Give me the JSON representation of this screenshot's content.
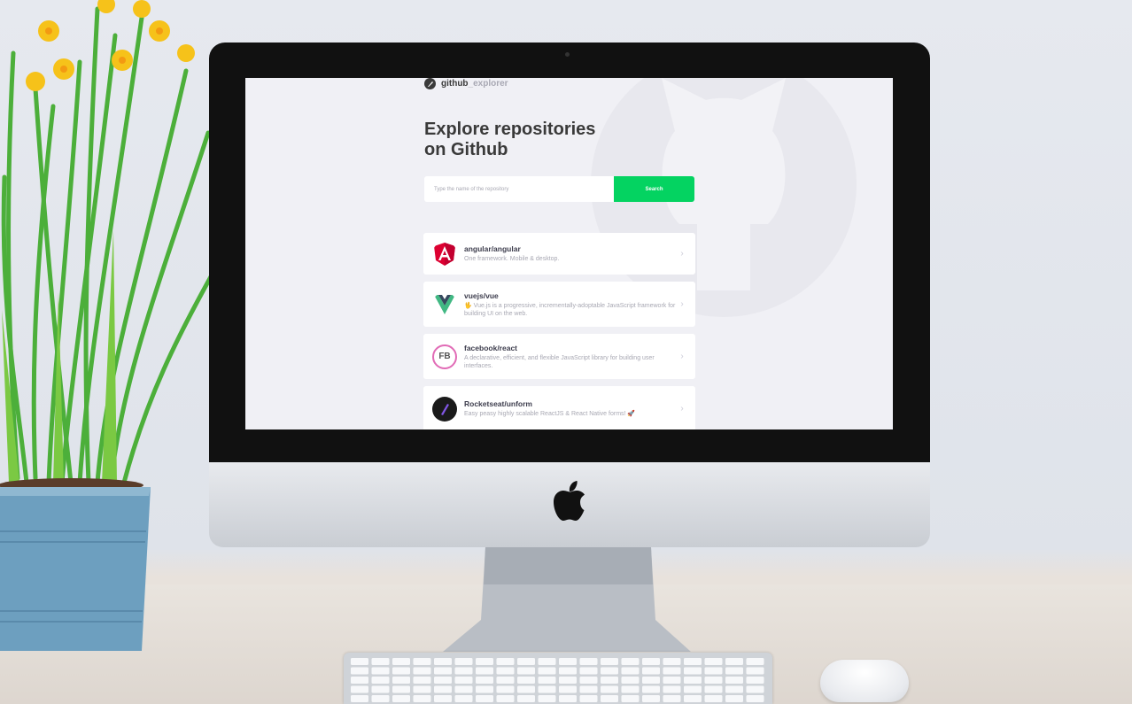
{
  "app": {
    "brand_name": "github",
    "brand_suffix": "_explorer",
    "title_line1": "Explore repositories",
    "title_line2": "on Github"
  },
  "search": {
    "placeholder": "Type the name of the repository",
    "button_label": "Search"
  },
  "repositories": [
    {
      "name": "angular/angular",
      "description": "One framework. Mobile & desktop.",
      "avatar_icon": "angular-logo-icon"
    },
    {
      "name": "vuejs/vue",
      "description": "🖖 Vue.js is a progressive, incrementally-adoptable JavaScript framework for building UI on the web.",
      "avatar_icon": "vue-logo-icon"
    },
    {
      "name": "facebook/react",
      "description": "A declarative, efficient, and flexible JavaScript library for building user interfaces.",
      "avatar_icon": "fb-logo-icon"
    },
    {
      "name": "Rocketseat/unform",
      "description": "Easy peasy highly scalable ReactJS & React Native forms! 🚀",
      "avatar_icon": "rocketseat-logo-icon"
    }
  ],
  "colors": {
    "accent": "#04d361",
    "screen_bg": "#f0f0f5",
    "text_dark": "#3a3a3a",
    "text_muted": "#a8a8b3"
  }
}
